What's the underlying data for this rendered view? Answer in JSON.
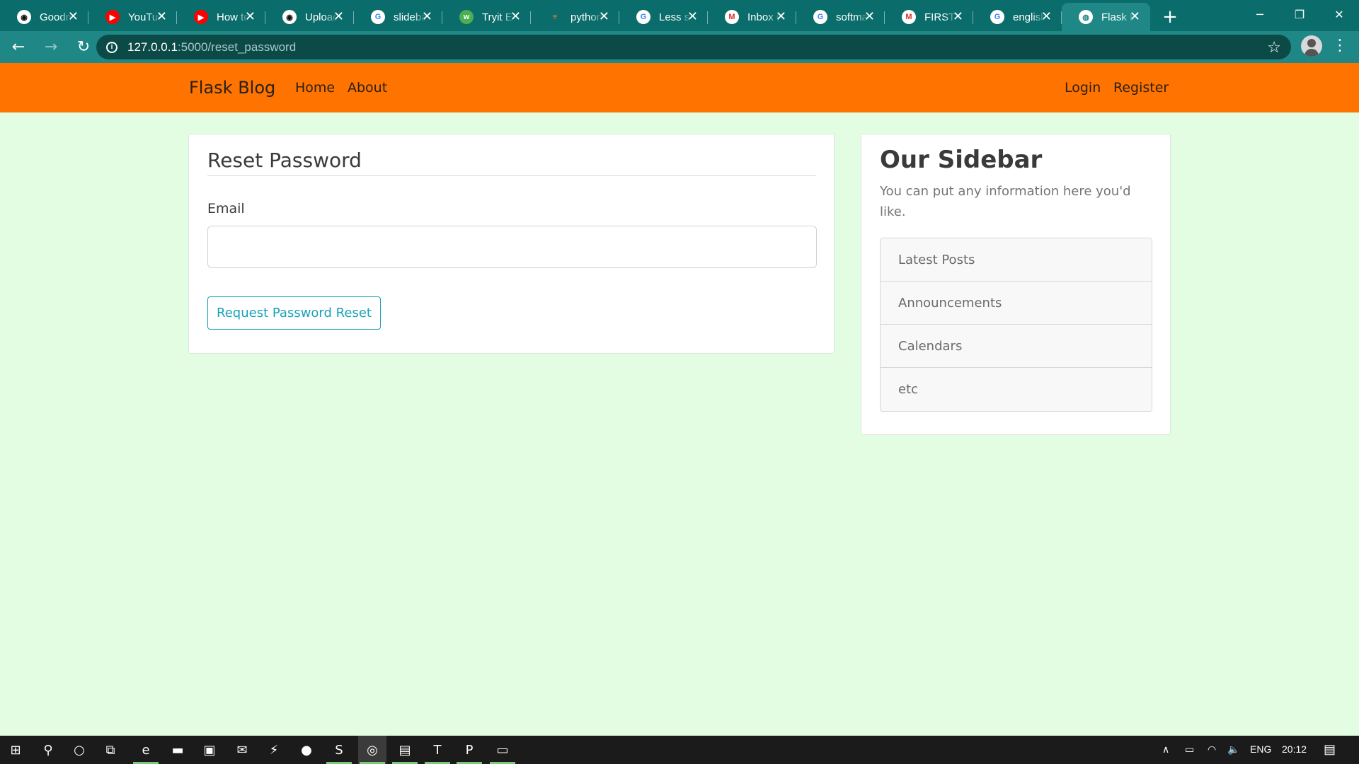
{
  "browser": {
    "tabs": [
      {
        "title": "Goodn",
        "icon": "github-icon",
        "icon_bg": "#ffffff",
        "icon_fg": "#111111",
        "glyph": "◉"
      },
      {
        "title": "YouTub",
        "icon": "youtube-icon",
        "icon_bg": "#ff0000",
        "icon_fg": "#ffffff",
        "glyph": "▶"
      },
      {
        "title": "How to",
        "icon": "youtube-icon",
        "icon_bg": "#ff0000",
        "icon_fg": "#ffffff",
        "glyph": "▶"
      },
      {
        "title": "Upload",
        "icon": "github-icon",
        "icon_bg": "#ffffff",
        "icon_fg": "#111111",
        "glyph": "◉"
      },
      {
        "title": "slideba",
        "icon": "google-icon",
        "icon_bg": "#ffffff",
        "icon_fg": "#4285f4",
        "glyph": "G"
      },
      {
        "title": "Tryit Ed",
        "icon": "w3schools-icon",
        "icon_bg": "#4caf50",
        "icon_fg": "#ffffff",
        "glyph": "w"
      },
      {
        "title": "python",
        "icon": "stackoverflow-icon",
        "icon_bg": "transparent",
        "icon_fg": "#f48024",
        "glyph": "≡"
      },
      {
        "title": "Less se",
        "icon": "google-icon",
        "icon_bg": "#ffffff",
        "icon_fg": "#4285f4",
        "glyph": "G"
      },
      {
        "title": "Inbox (",
        "icon": "gmail-icon",
        "icon_bg": "#ffffff",
        "icon_fg": "#d93025",
        "glyph": "M"
      },
      {
        "title": "softma",
        "icon": "google-icon",
        "icon_bg": "#ffffff",
        "icon_fg": "#4285f4",
        "glyph": "G"
      },
      {
        "title": "FIRST I",
        "icon": "gmail-icon",
        "icon_bg": "#ffffff",
        "icon_fg": "#d93025",
        "glyph": "M"
      },
      {
        "title": "english",
        "icon": "google-icon",
        "icon_bg": "#ffffff",
        "icon_fg": "#4285f4",
        "glyph": "G"
      },
      {
        "title": "Flask B",
        "icon": "globe-icon",
        "icon_bg": "#ffffff",
        "icon_fg": "#1f8785",
        "glyph": "◍",
        "active": true
      }
    ],
    "tab_close_glyph": "✕",
    "new_tab_glyph": "+",
    "window_controls": {
      "minimize": "─",
      "restore": "❐",
      "close": "✕"
    },
    "back_glyph": "←",
    "forward_glyph": "→",
    "reload_glyph": "↻",
    "info_glyph": "i",
    "url_host": "127.0.0.1",
    "url_rest": ":5000/reset_password",
    "star_glyph": "☆",
    "menu_glyph": "⋮"
  },
  "site": {
    "brand": "Flask Blog",
    "nav_left": [
      "Home",
      "About"
    ],
    "nav_right": [
      "Login",
      "Register"
    ],
    "nav_color": "#ff7400",
    "page_bg": "#e2fde2"
  },
  "reset_form": {
    "title": "Reset Password",
    "email_label": "Email",
    "email_value": "",
    "submit_label": "Request Password Reset",
    "accent": "#17a2b8"
  },
  "sidebar": {
    "title": "Our Sidebar",
    "text": "You can put any information here you'd like.",
    "items": [
      "Latest Posts",
      "Announcements",
      "Calendars",
      "etc"
    ]
  },
  "taskbar": {
    "apps": [
      {
        "name": "start-button",
        "glyph": "⊞"
      },
      {
        "name": "search-icon",
        "glyph": "⚲"
      },
      {
        "name": "cortana-icon",
        "glyph": "○"
      },
      {
        "name": "task-view-icon",
        "glyph": "⧉"
      },
      {
        "name": "edge-icon",
        "glyph": "e",
        "running": true
      },
      {
        "name": "file-explorer-icon",
        "glyph": "▬"
      },
      {
        "name": "store-icon",
        "glyph": "▣"
      },
      {
        "name": "mail-icon",
        "glyph": "✉"
      },
      {
        "name": "lightning-app-icon",
        "glyph": "⚡"
      },
      {
        "name": "round-app-icon",
        "glyph": "●"
      },
      {
        "name": "sublime-text-icon",
        "glyph": "S",
        "running": true
      },
      {
        "name": "chrome-icon",
        "glyph": "◎",
        "running": true,
        "active": true
      },
      {
        "name": "archive-icon",
        "glyph": "▤",
        "running": true
      },
      {
        "name": "typora-icon",
        "glyph": "T",
        "running": true
      },
      {
        "name": "powerpoint-icon",
        "glyph": "P",
        "running": true
      },
      {
        "name": "terminal-icon",
        "glyph": "▭",
        "running": true
      }
    ],
    "tray": {
      "chevron": "∧",
      "battery": "▭",
      "wifi": "◠",
      "volume": "🔈",
      "language": "ENG",
      "time": "20:12",
      "notifications": "▤"
    }
  }
}
